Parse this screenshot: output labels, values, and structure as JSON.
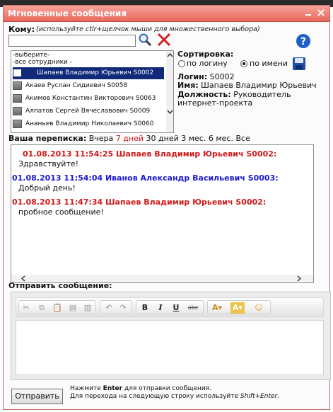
{
  "window": {
    "title": "Мгновенные сообщения"
  },
  "to": {
    "label": "Кому:",
    "hint": "(используйте ctlr+щелчок мыши для множественного выбора)",
    "value": "",
    "list_options": [
      "-выберите-",
      "-все сотрудники -"
    ],
    "employees": [
      {
        "name": "Шапаев Владимир Юрьевич S0002",
        "selected": true
      },
      {
        "name": "Акаев Руслан Сидиевич S0058",
        "selected": false
      },
      {
        "name": "Акимов Константин Викторович S0063",
        "selected": false
      },
      {
        "name": "Алпатов Сергей Вячеславович S0009",
        "selected": false
      },
      {
        "name": "Ананьев Владимир Николаевич S0060",
        "selected": false
      }
    ]
  },
  "sort": {
    "label": "Сортировка:",
    "by_login": "по логину",
    "by_name": "по имени",
    "selected": "by_name"
  },
  "profile": {
    "login_label": "Логин:",
    "login": "S0002",
    "name_label": "Имя:",
    "name": "Шапаев Владимир Юрьевич",
    "position_label": "Должность:",
    "position_line1": "Руководитель",
    "position_line2": "интернет-проекта"
  },
  "history": {
    "label": "Ваша переписка:",
    "filters": [
      "Вчера",
      "7 дней",
      "30 дней",
      "3 мес.",
      "6 мес.",
      "Все"
    ],
    "active_filter": "7 дней",
    "messages": [
      {
        "header": "01.08.2013 11:54:25 Шапаев Владимир Юрьевич S0002:",
        "text": "Здравствуйте!",
        "color": "#d01a1a"
      },
      {
        "header": "01.08.2013 11:54:04 Иванов Александр Васильевич S0003:",
        "text": "Добрый день!",
        "color": "#1a1ad0"
      },
      {
        "header": "01.08.2013 11:47:34 Шапаев Владимир Юрьевич S0002:",
        "text": "пробное сообщение!",
        "color": "#d01a1a"
      }
    ]
  },
  "compose": {
    "label": "Отправить сообщение:",
    "send_button": "Отправить",
    "note_line1_prefix": "Нажмите ",
    "note_line1_key": "Enter",
    "note_line1_suffix": " для отправки сообщения.",
    "note_line2_prefix": "Для перехода на следующую строку используйте ",
    "note_line2_key": "Shift+Enter",
    "note_line2_suffix": "."
  },
  "toolbar": {
    "bold": "B",
    "italic": "I",
    "underline": "U",
    "strike": "abc",
    "text_color": "A",
    "bg_color": "A"
  },
  "colors": {
    "title_bar": "#e9675c",
    "selected_row": "#0f2a78",
    "accent_red": "#d01a1a",
    "accent_blue": "#1a1ad0"
  }
}
